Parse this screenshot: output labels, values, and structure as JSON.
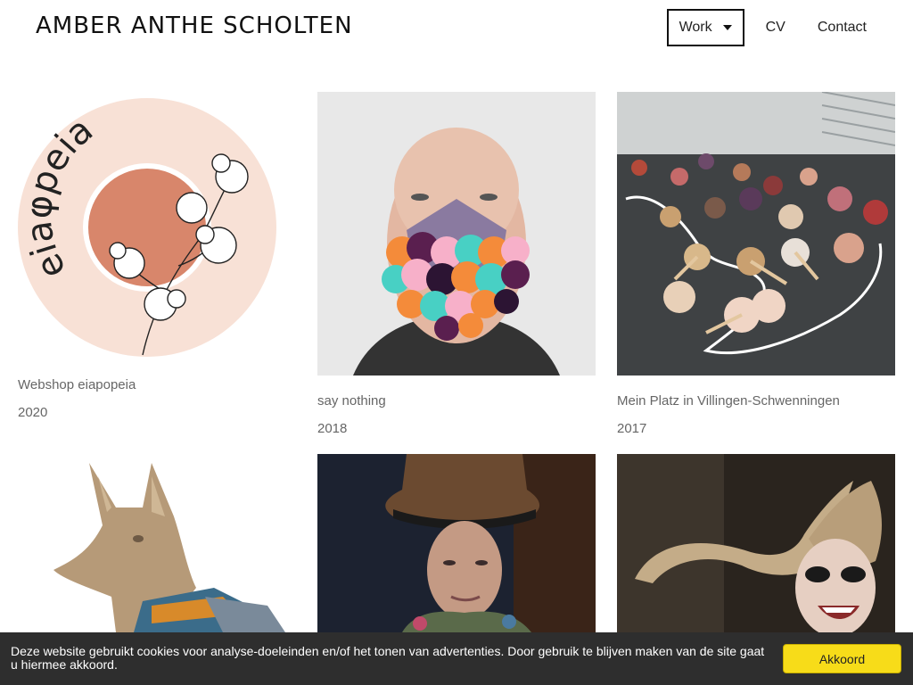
{
  "header": {
    "site_title": "AMBER ANTHE SCHOLTEN",
    "nav": {
      "work": "Work",
      "cv": "CV",
      "contact": "Contact"
    }
  },
  "logo": {
    "brand_text": "eiaφpeia"
  },
  "projects": [
    {
      "title": "Webshop eiapopeia",
      "year": "2020"
    },
    {
      "title": "say nothing",
      "year": "2018"
    },
    {
      "title": "Mein Platz in Villingen-Schwenningen",
      "year": "2017"
    },
    {
      "title": "",
      "year": ""
    },
    {
      "title": "",
      "year": ""
    },
    {
      "title": "",
      "year": ""
    }
  ],
  "cookie": {
    "message": "Deze website gebruikt cookies voor analyse-doeleinden en/of het tonen van advertenties. Door gebruik te blijven maken van de site gaat u hiermee akkoord.",
    "accept_label": "Akkoord"
  },
  "colors": {
    "cookie_bar": "#2e2e2e",
    "accept_button": "#f7dc19",
    "logo_bg": "#f8e1d6",
    "logo_circle": "#d8866b"
  }
}
